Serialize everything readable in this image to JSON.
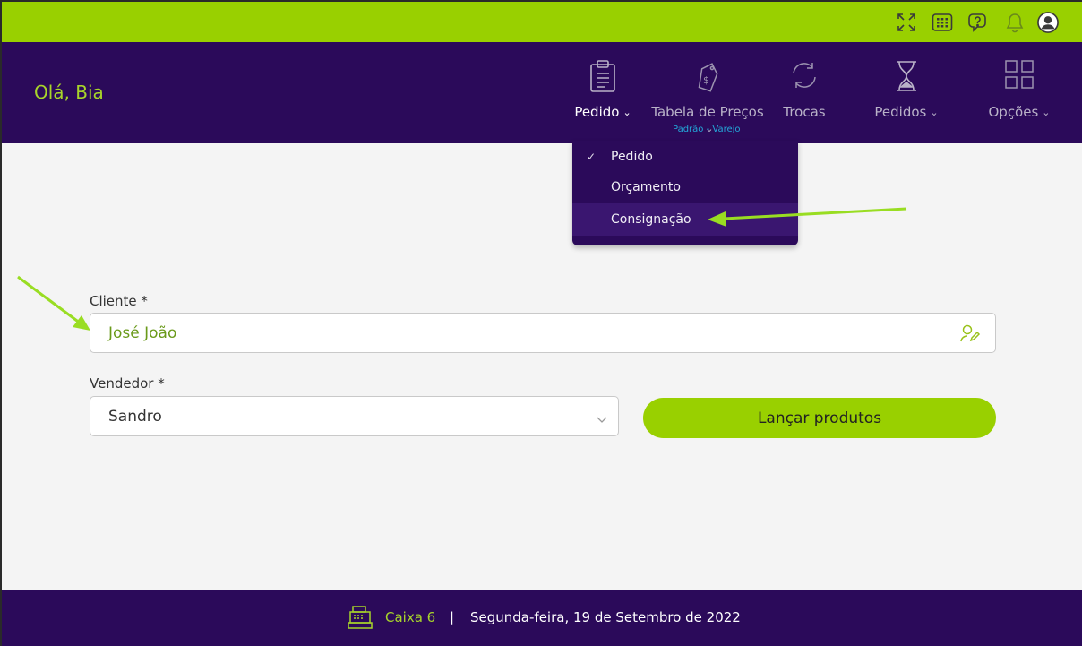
{
  "greeting": "Olá, Bia",
  "topbar": {
    "icons": [
      "fullscreen-icon",
      "keypad-icon",
      "help-chat-icon",
      "bell-icon",
      "user-avatar-icon"
    ]
  },
  "nav": {
    "items": [
      {
        "label": "Pedido",
        "icon": "clipboard-icon",
        "has_chevron": true,
        "active": true
      },
      {
        "label": "Tabela de Preços",
        "icon": "price-tag-icon",
        "has_chevron": true,
        "caption": "Padrão - Varejo"
      },
      {
        "label": "Trocas",
        "icon": "refresh-icon",
        "has_chevron": false
      },
      {
        "label": "Pedidos",
        "icon": "hourglass-icon",
        "has_chevron": true
      },
      {
        "label": "Opções",
        "icon": "grid-icon",
        "has_chevron": true
      }
    ],
    "chevron": "⌄"
  },
  "dropdown": {
    "items": [
      {
        "label": "Pedido",
        "checked": true
      },
      {
        "label": "Orçamento",
        "checked": false
      },
      {
        "label": "Consignação",
        "checked": false,
        "highlighted": true
      }
    ],
    "check": "✓"
  },
  "form": {
    "cliente_label": "Cliente *",
    "cliente_value": "José João",
    "vendedor_label": "Vendedor *",
    "vendedor_value": "Sandro",
    "submit_label": "Lançar produtos"
  },
  "footer": {
    "caixa": "Caixa 6",
    "separator": "|",
    "date": "Segunda-feira, 19 de Setembro de 2022"
  },
  "colors": {
    "accent": "#99d000",
    "header_bg": "#2b0a5a",
    "greeting": "#a8d52a",
    "caption": "#23a7d9"
  }
}
